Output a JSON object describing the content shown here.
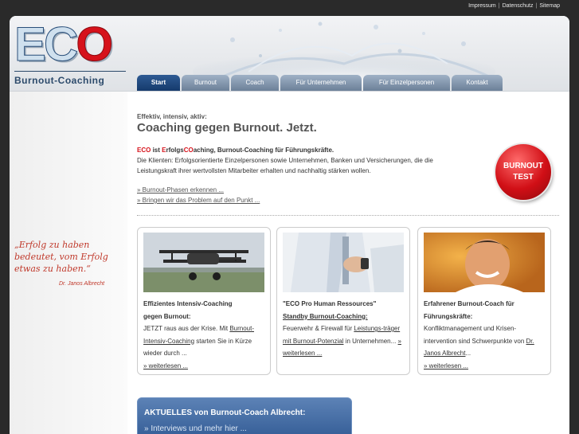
{
  "toplinks": [
    "Impressum",
    "Datenschutz",
    "Sitemap"
  ],
  "logo": {
    "eco_prefix": "EC",
    "eco_o": "O",
    "subtitle": "Burnout-Coaching"
  },
  "nav": [
    {
      "label": "Start",
      "active": true
    },
    {
      "label": "Burnout",
      "active": false
    },
    {
      "label": "Coach",
      "active": false
    },
    {
      "label": "Für Unternehmen",
      "active": false
    },
    {
      "label": "Für Einzelpersonen",
      "active": false
    },
    {
      "label": "Kontakt",
      "active": false
    }
  ],
  "sidebar": {
    "quote": "„Erfolg zu haben bedeutet, vom Erfolg etwas zu haben.“",
    "author": "Dr. Janos Albrecht"
  },
  "main": {
    "kicker": "Effektiv, intensiv, aktiv:",
    "headline": "Coaching gegen Burnout. Jetzt.",
    "intro_eco": "ECO",
    "intro_ist": " ist ",
    "intro_e": "E",
    "intro_rfolgs": "rfolgs",
    "intro_co": "CO",
    "intro_rest": "aching, Burnout-Coaching für Führungskräfte.",
    "intro_body": "Die Klienten: Erfolgsorientierte Einzelpersonen sowie Unternehmen, Banken und Versicherungen, die die Leistungskraft ihrer wertvollsten Mitarbeiter erhalten und nachhaltig stärken wollen.",
    "link1": "» Burnout-Phasen erkennen ...",
    "link2": "» Bringen wir das Problem auf den Punkt ..."
  },
  "burnout_test": {
    "line1": "BURNOUT",
    "line2": "TEST"
  },
  "cards": [
    {
      "title1": "Effizientes Intensiv-Coaching",
      "title2": "gegen Burnout:",
      "text_a": "JETZT raus aus der Krise. Mit ",
      "link": "Burnout-Intensiv-Coaching",
      "text_b": " starten Sie in Kürze wieder durch ...",
      "more": "» weiterlesen ..."
    },
    {
      "title1": "\"ECO Pro Human Ressources\"",
      "title2": "Standby Burnout-Coaching:",
      "text_a": "Feuerwehr & Firewall für ",
      "link": "Leistungs-träger mit Burnout-Potenzial",
      "text_b": " in Unternehmen... ",
      "more": "» weiterlesen ..."
    },
    {
      "title1": "Erfahrener Burnout-Coach für",
      "title2": "Führungskräfte:",
      "text_a": "Konfliktmanagement und Krisen-intervention sind Schwerpunkte von ",
      "link": "Dr. Janos Albrecht",
      "text_b": "...",
      "more": "» weiterlesen ..."
    }
  ],
  "news": {
    "heading": "AKTUELLES von Burnout-Coach Albrecht:",
    "link": "» Interviews und mehr hier ..."
  },
  "colors": {
    "accent_red": "#d6121b",
    "nav_active": "#1f4a80",
    "nav_inactive": "#7f93ab",
    "news_bg": "#3f67a0"
  }
}
